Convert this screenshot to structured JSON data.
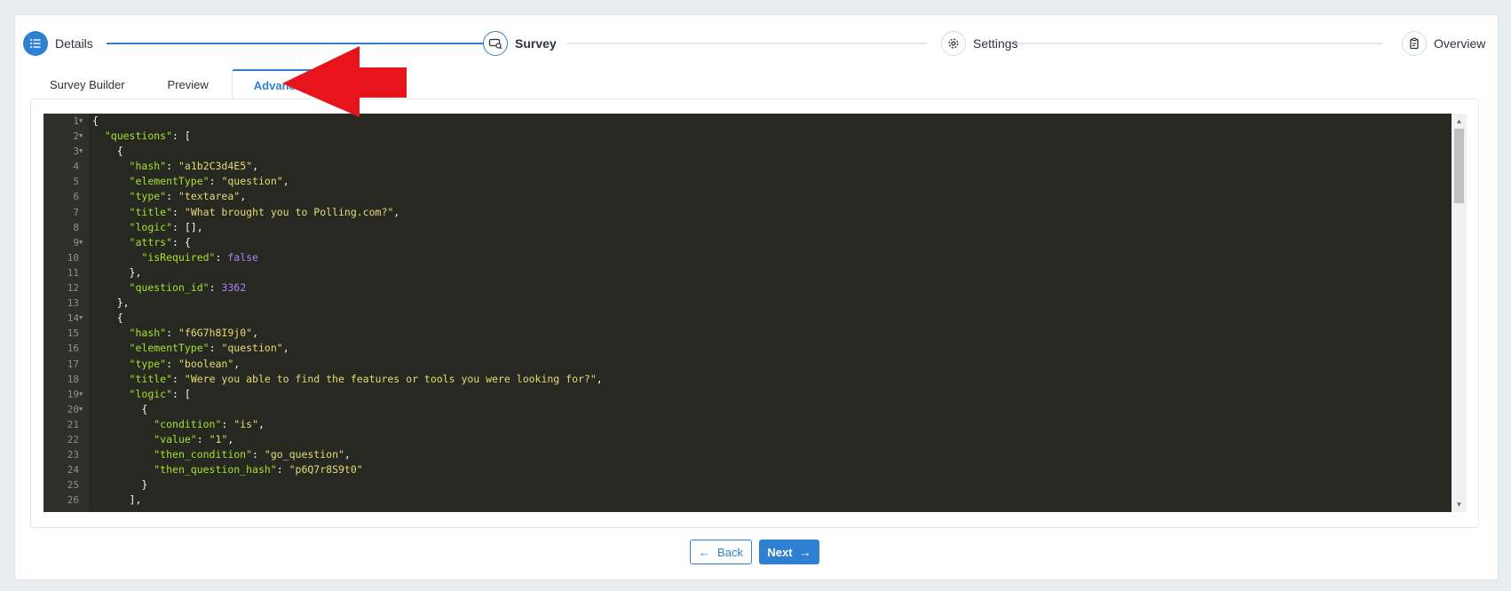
{
  "stepper": {
    "steps": [
      {
        "label": "Details",
        "icon": "list-icon",
        "state": "done"
      },
      {
        "label": "Survey",
        "icon": "survey-icon",
        "state": "active"
      },
      {
        "label": "Settings",
        "icon": "gear-icon",
        "state": "todo"
      },
      {
        "label": "Overview",
        "icon": "clipboard-icon",
        "state": "todo"
      }
    ]
  },
  "tabs": [
    {
      "label": "Survey Builder"
    },
    {
      "label": "Preview"
    },
    {
      "label": "Advanced"
    }
  ],
  "editor": {
    "lines": [
      {
        "n": "1",
        "fold": true,
        "text": "{"
      },
      {
        "n": "2",
        "fold": true,
        "text": "  \"questions\": ["
      },
      {
        "n": "3",
        "fold": true,
        "text": "    {"
      },
      {
        "n": "4",
        "fold": false,
        "text": "      \"hash\": \"a1b2C3d4E5\","
      },
      {
        "n": "5",
        "fold": false,
        "text": "      \"elementType\": \"question\","
      },
      {
        "n": "6",
        "fold": false,
        "text": "      \"type\": \"textarea\","
      },
      {
        "n": "7",
        "fold": false,
        "text": "      \"title\": \"What brought you to Polling.com?\","
      },
      {
        "n": "8",
        "fold": false,
        "text": "      \"logic\": [],"
      },
      {
        "n": "9",
        "fold": true,
        "text": "      \"attrs\": {"
      },
      {
        "n": "10",
        "fold": false,
        "text": "        \"isRequired\": false"
      },
      {
        "n": "11",
        "fold": false,
        "text": "      },"
      },
      {
        "n": "12",
        "fold": false,
        "text": "      \"question_id\": 3362"
      },
      {
        "n": "13",
        "fold": false,
        "text": "    },"
      },
      {
        "n": "14",
        "fold": true,
        "text": "    {"
      },
      {
        "n": "15",
        "fold": false,
        "text": "      \"hash\": \"f6G7h8I9j0\","
      },
      {
        "n": "16",
        "fold": false,
        "text": "      \"elementType\": \"question\","
      },
      {
        "n": "17",
        "fold": false,
        "text": "      \"type\": \"boolean\","
      },
      {
        "n": "18",
        "fold": false,
        "text": "      \"title\": \"Were you able to find the features or tools you were looking for?\","
      },
      {
        "n": "19",
        "fold": true,
        "text": "      \"logic\": ["
      },
      {
        "n": "20",
        "fold": true,
        "text": "        {"
      },
      {
        "n": "21",
        "fold": false,
        "text": "          \"condition\": \"is\","
      },
      {
        "n": "22",
        "fold": false,
        "text": "          \"value\": \"1\","
      },
      {
        "n": "23",
        "fold": false,
        "text": "          \"then_condition\": \"go_question\","
      },
      {
        "n": "24",
        "fold": false,
        "text": "          \"then_question_hash\": \"p6Q7r8S9t0\""
      },
      {
        "n": "25",
        "fold": false,
        "text": "        }"
      },
      {
        "n": "26",
        "fold": false,
        "text": "      ],"
      }
    ]
  },
  "buttons": {
    "back_label": "Back",
    "next_label": "Next"
  },
  "colors": {
    "accent": "#2f80d1",
    "annotation": "#e8141b",
    "editor_bg": "#272822",
    "json_key": "#a6e22e",
    "json_string": "#e6db74",
    "json_number": "#ae81ff"
  }
}
